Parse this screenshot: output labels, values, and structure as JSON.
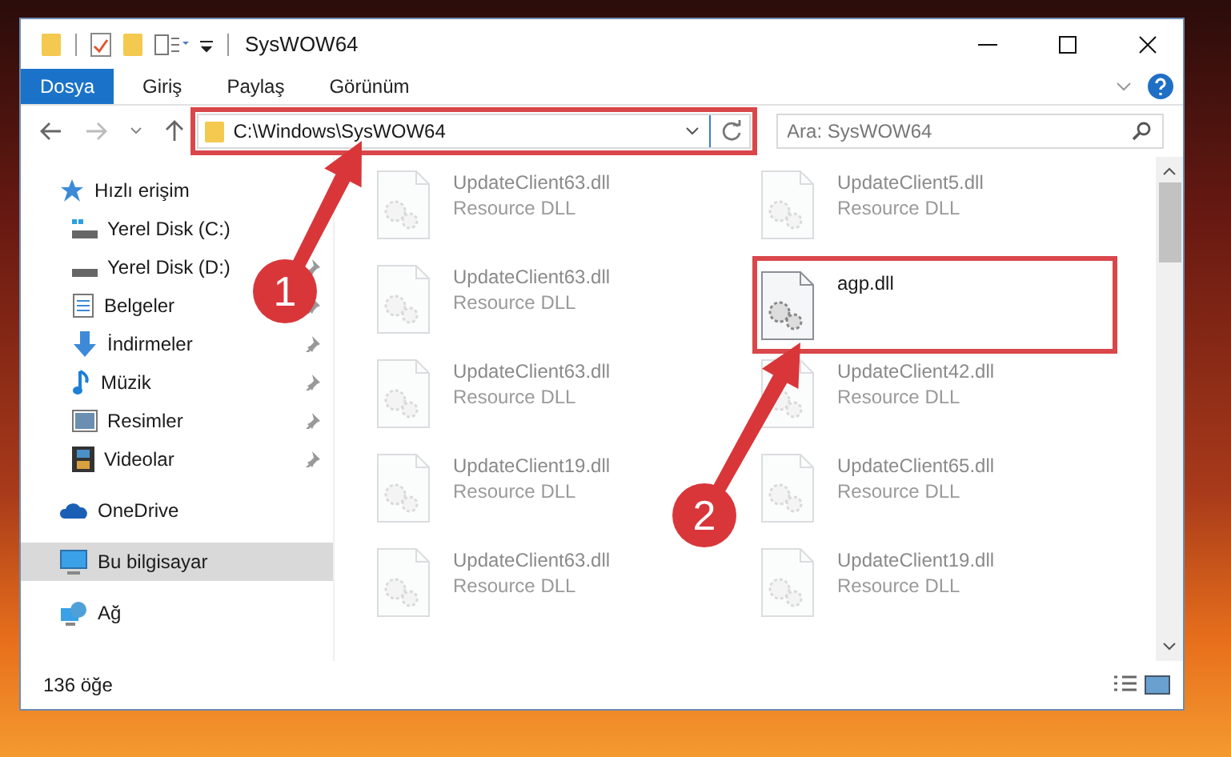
{
  "window": {
    "title": "SysWOW64"
  },
  "ribbon_tabs": [
    {
      "label": "Dosya",
      "selected": true
    },
    {
      "label": "Giriş",
      "selected": false
    },
    {
      "label": "Paylaş",
      "selected": false
    },
    {
      "label": "Görünüm",
      "selected": false
    }
  ],
  "address_bar": {
    "path": "C:\\Windows\\SysWOW64",
    "highlighted": true
  },
  "search": {
    "placeholder": "Ara: SysWOW64"
  },
  "sidebar": {
    "items": [
      {
        "label": "Hızlı erişim",
        "kind": "quick",
        "selected": false,
        "children": [
          {
            "label": "Yerel Disk (C:)",
            "kind": "windrive",
            "pinned": false,
            "selected": false
          },
          {
            "label": "Yerel Disk (D:)",
            "kind": "drive",
            "pinned": true,
            "selected": false
          },
          {
            "label": "Belgeler",
            "kind": "documents",
            "pinned": true,
            "selected": false
          },
          {
            "label": "İndirmeler",
            "kind": "downloads",
            "pinned": true,
            "selected": false
          },
          {
            "label": "Müzik",
            "kind": "music",
            "pinned": true,
            "selected": false
          },
          {
            "label": "Resimler",
            "kind": "pictures",
            "pinned": true,
            "selected": false
          },
          {
            "label": "Videolar",
            "kind": "videos",
            "pinned": true,
            "selected": false
          }
        ]
      },
      {
        "label": "OneDrive",
        "kind": "onedrive",
        "selected": false
      },
      {
        "label": "Bu bilgisayar",
        "kind": "computer",
        "selected": true
      },
      {
        "label": "Ağ",
        "kind": "network",
        "selected": false
      }
    ]
  },
  "files": [
    {
      "name": "UpdateClient63.dll",
      "type": "Resource DLL",
      "faded": true,
      "highlighted": false
    },
    {
      "name": "UpdateClient5.dll",
      "type": "Resource DLL",
      "faded": true,
      "highlighted": false
    },
    {
      "name": "UpdateClient63.dll",
      "type": "Resource DLL",
      "faded": true,
      "highlighted": false
    },
    {
      "name": "agp.dll",
      "faded": false,
      "highlighted": true
    },
    {
      "name": "UpdateClient63.dll",
      "type": "Resource DLL",
      "faded": true,
      "highlighted": false
    },
    {
      "name": "UpdateClient42.dll",
      "type": "Resource DLL",
      "faded": true,
      "highlighted": false
    },
    {
      "name": "UpdateClient19.dll",
      "type": "Resource DLL",
      "faded": true,
      "highlighted": false
    },
    {
      "name": "UpdateClient65.dll",
      "type": "Resource DLL",
      "faded": true,
      "highlighted": false
    },
    {
      "name": "UpdateClient63.dll",
      "type": "Resource DLL",
      "faded": true,
      "highlighted": false
    },
    {
      "name": "UpdateClient19.dll",
      "type": "Resource DLL",
      "faded": true,
      "highlighted": false
    }
  ],
  "status_bar": {
    "item_count": "136 öğe"
  },
  "annotations": [
    {
      "number": "1",
      "kind": "step1"
    },
    {
      "number": "2",
      "kind": "step2"
    }
  ]
}
